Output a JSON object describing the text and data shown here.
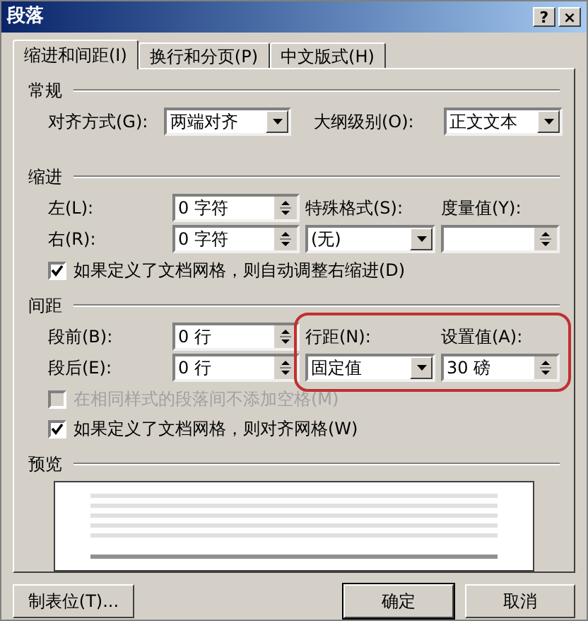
{
  "window": {
    "title": "段落",
    "buttons": [
      "?",
      "×"
    ]
  },
  "tabs": [
    {
      "label": "缩进和间距(I)",
      "selected": true
    },
    {
      "label": "换行和分页(P)",
      "selected": false
    },
    {
      "label": "中文版式(H)",
      "selected": false
    }
  ],
  "general": {
    "heading": "常规",
    "alignment": {
      "label": "对齐方式(G):",
      "value": "两端对齐"
    },
    "outline_level": {
      "label": "大纲级别(O):",
      "value": "正文文本"
    }
  },
  "indentation": {
    "heading": "缩进",
    "left": {
      "label": "左(L):",
      "value": "0 字符"
    },
    "right": {
      "label": "右(R):",
      "value": "0 字符"
    },
    "special": {
      "label": "特殊格式(S):",
      "value": "(无)"
    },
    "by": {
      "label": "度量值(Y):"
    },
    "checkbox": {
      "label": "如果定义了文档网格，则自动调整右缩进(D)",
      "checked": true,
      "disabled": false
    }
  },
  "spacing": {
    "heading": "间距",
    "before": {
      "label": "段前(B):",
      "value": "0 行"
    },
    "after": {
      "label": "段后(E):",
      "value": "0 行"
    },
    "line_spacing": {
      "label": "行距(N):",
      "value": "固定值"
    },
    "at": {
      "label": "设置值(A):",
      "value": "30 磅"
    },
    "checkboxes": [
      {
        "label": "在相同样式的段落间不添加空格(M)",
        "checked": false,
        "disabled": true
      },
      {
        "label": "如果定义了文档网格，则对齐网格(W)",
        "checked": true,
        "disabled": false
      }
    ]
  },
  "preview": {
    "heading": "预览"
  },
  "buttons": [
    {
      "label": "制表位(T)...",
      "default": false
    },
    {
      "label": "确定",
      "default": true
    },
    {
      "label": "取消",
      "default": false
    }
  ]
}
